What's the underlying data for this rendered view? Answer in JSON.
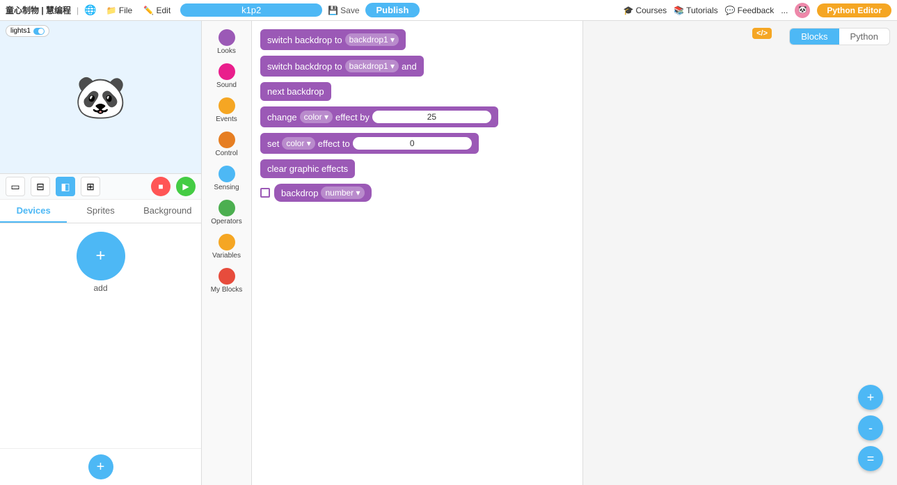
{
  "topbar": {
    "logo": "童心制物 | 慧编程",
    "menu": {
      "file": "File",
      "edit": "Edit"
    },
    "project_name": "k1p2",
    "save_label": "Save",
    "publish_label": "Publish",
    "right": {
      "courses": "Courses",
      "tutorials": "Tutorials",
      "feedback": "Feedback",
      "more": "..."
    },
    "python_editor_label": "Python Editor"
  },
  "stage": {
    "light_toggle_label": "lights1"
  },
  "controls": {
    "stop_icon": "■",
    "go_icon": "▶"
  },
  "panel_tabs": {
    "devices": "Devices",
    "sprites": "Sprites",
    "background": "Background"
  },
  "add_device": {
    "label": "add"
  },
  "palette": {
    "items": [
      {
        "id": "looks",
        "label": "Looks",
        "color": "#9b59b6"
      },
      {
        "id": "sound",
        "label": "Sound",
        "color": "#e91e8c"
      },
      {
        "id": "events",
        "label": "Events",
        "color": "#f5a623"
      },
      {
        "id": "control",
        "label": "Control",
        "color": "#e67e22"
      },
      {
        "id": "sensing",
        "label": "Sensing",
        "color": "#4db8f5"
      },
      {
        "id": "operators",
        "label": "Operators",
        "color": "#4caf50"
      },
      {
        "id": "variables",
        "label": "Variables",
        "color": "#f5a623"
      },
      {
        "id": "my_blocks",
        "label": "My Blocks",
        "color": "#e74c3c"
      }
    ]
  },
  "blocks": [
    {
      "id": "switch-backdrop-1",
      "type": "command",
      "text": "switch backdrop to",
      "dropdown": "backdrop1",
      "color": "purple"
    },
    {
      "id": "switch-backdrop-2",
      "type": "command",
      "text": "switch backdrop to",
      "dropdown": "backdrop1",
      "suffix": "and",
      "color": "purple"
    },
    {
      "id": "next-backdrop",
      "type": "command",
      "text": "next backdrop",
      "color": "purple"
    },
    {
      "id": "change-color-effect",
      "type": "command",
      "prefix": "change",
      "effect": "color",
      "middle": "effect by",
      "value": "25",
      "color": "purple"
    },
    {
      "id": "set-color-effect",
      "type": "command",
      "prefix": "set",
      "effect": "color",
      "middle": "effect to",
      "value": "0",
      "color": "purple"
    },
    {
      "id": "clear-graphic-effects",
      "type": "command",
      "text": "clear graphic effects",
      "color": "purple"
    },
    {
      "id": "backdrop-number",
      "type": "reporter",
      "dropdown": "number",
      "prefix": "backdrop",
      "has_checkbox": true
    }
  ],
  "view_toggle": {
    "blocks_label": "Blocks",
    "python_label": "Python"
  },
  "xml_label": "</>",
  "zoom": {
    "zoom_in": "+",
    "zoom_out": "-",
    "zoom_fit": "="
  }
}
